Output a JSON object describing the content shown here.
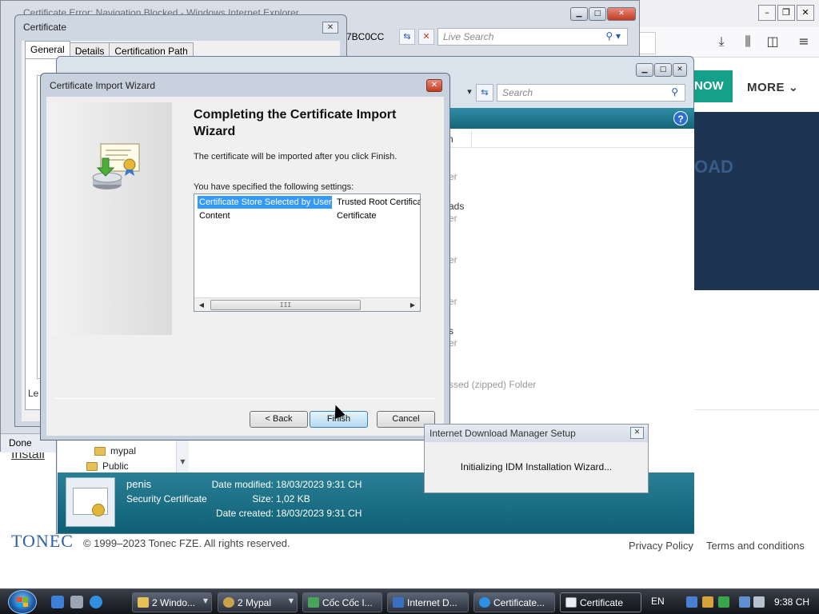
{
  "firefox": {
    "now_button": "NOW",
    "more_menu": "MORE",
    "hero_text": "OAD",
    "install_link": "Install",
    "footer_logo": "TONEC",
    "copyright": "© 1999–2023 Tonec FZE. All rights reserved.",
    "links": [
      "Privacy Policy",
      "Terms and conditions"
    ]
  },
  "ie": {
    "title": "Certificate Error: Navigation Blocked - Windows Internet Explorer",
    "address_fragment": "7BC0CC",
    "search_placeholder": "Live Search",
    "status": "Done"
  },
  "certificate_dialog": {
    "title": "Certificate",
    "tabs": [
      "General",
      "Details",
      "Certification Path"
    ],
    "fragment": "Le"
  },
  "explorer": {
    "search_placeholder": "Search",
    "column_fragment": "n",
    "fragments": [
      "er",
      "ads",
      "er",
      "er",
      "er",
      "s",
      "er",
      "ssed (zipped) Folder"
    ],
    "nav_items": [
      "mypal",
      "Public"
    ],
    "details": {
      "name": "penis",
      "type": "Security Certificate",
      "labels": [
        "Date modified:",
        "Size:",
        "Date created:"
      ],
      "values": [
        "18/03/2023 9:31 CH",
        "1,02 KB",
        "18/03/2023 9:31 CH"
      ]
    }
  },
  "wizard": {
    "title": "Certificate Import Wizard",
    "heading": "Completing the Certificate Import Wizard",
    "intro": "The certificate will be imported after you click Finish.",
    "settings_label": "You have specified the following settings:",
    "settings": [
      {
        "key": "Certificate Store Selected by User",
        "value": "Trusted Root Certifica"
      },
      {
        "key": "Content",
        "value": "Certificate"
      }
    ],
    "scroll_grip": "III",
    "buttons": {
      "back": "< Back",
      "finish": "Finish",
      "cancel": "Cancel"
    }
  },
  "idm": {
    "title": "Internet Download Manager Setup",
    "message": "Initializing IDM Installation Wizard..."
  },
  "taskbar": {
    "buttons": [
      "2 Windo...",
      "2 Mypal",
      "Cốc Cốc I...",
      "Internet D...",
      "Certificate...",
      "Certificate"
    ],
    "language": "EN",
    "clock": "9:38 CH"
  }
}
